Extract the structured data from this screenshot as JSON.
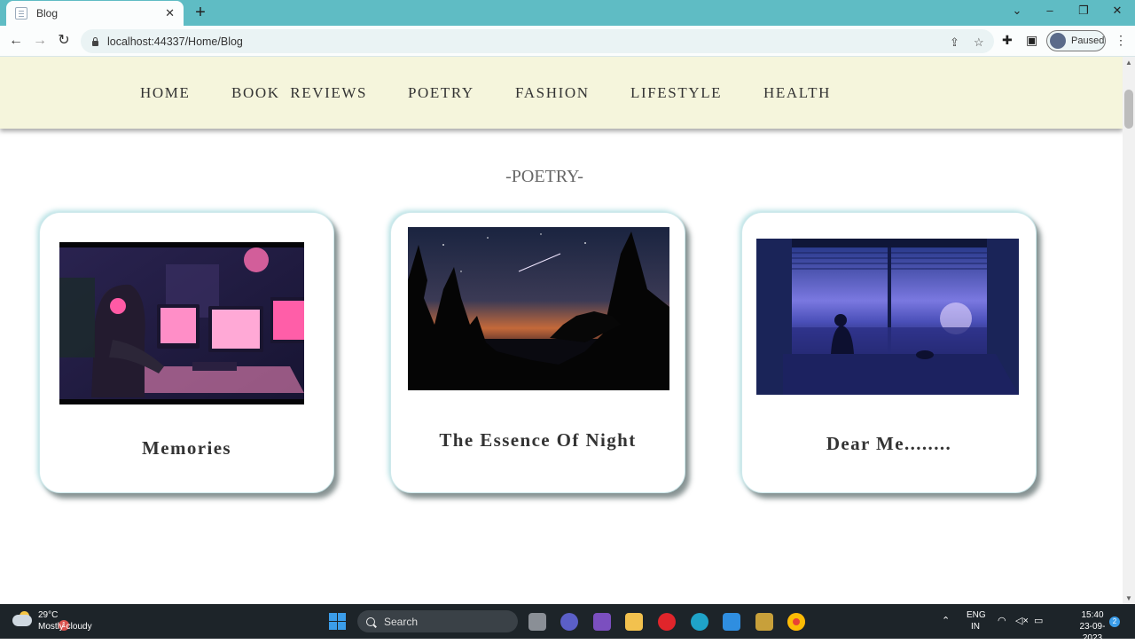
{
  "browser": {
    "tab_title": "Blog",
    "tab_close": "✕",
    "new_tab": "+",
    "url": "localhost:44337/Home/Blog",
    "profile_label": "Paused",
    "window_controls": [
      "⌄",
      "–",
      "❐",
      "✕"
    ],
    "nav": {
      "back": "←",
      "forward": "→",
      "reload": "↻"
    }
  },
  "site": {
    "nav": [
      "HOME",
      "BOOK  REVIEWS",
      "POETRY",
      "FASHION",
      "LIFESTYLE",
      "HEALTH"
    ],
    "section_title": "-POETRY-",
    "cards": [
      {
        "title": "Memories",
        "image": "lofi-girl-at-computer-image"
      },
      {
        "title": "The Essence Of Night",
        "image": "night-forest-sunset-image"
      },
      {
        "title": "Dear Me........",
        "image": "girl-by-window-city-image"
      }
    ]
  },
  "taskbar": {
    "weather_temp": "29°C",
    "weather_condition": "Mostly cloudy",
    "weather_badge": "1",
    "search_label": "Search",
    "lang_top": "ENG",
    "lang_bottom": "IN",
    "time": "15:40",
    "date": "23-09-2023",
    "notification_count": "2"
  },
  "colors": {
    "tabbar": "#5fbcc4",
    "site_nav_bg": "#f5f5dc",
    "taskbar_bg": "#1d2429"
  }
}
